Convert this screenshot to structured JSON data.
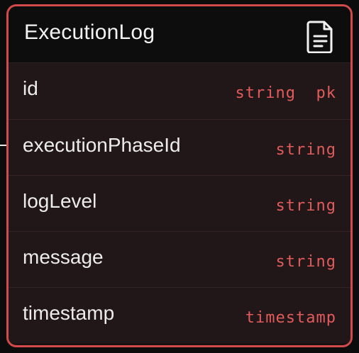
{
  "entity": {
    "title": "ExecutionLog",
    "icon": "document-icon",
    "border_color": "#d24a4a",
    "type_color": "#e05b5b",
    "fields": [
      {
        "name": "id",
        "type": "string  pk"
      },
      {
        "name": "executionPhaseId",
        "type": "string"
      },
      {
        "name": "logLevel",
        "type": "string"
      },
      {
        "name": "message",
        "type": "string"
      },
      {
        "name": "timestamp",
        "type": "timestamp"
      }
    ]
  }
}
